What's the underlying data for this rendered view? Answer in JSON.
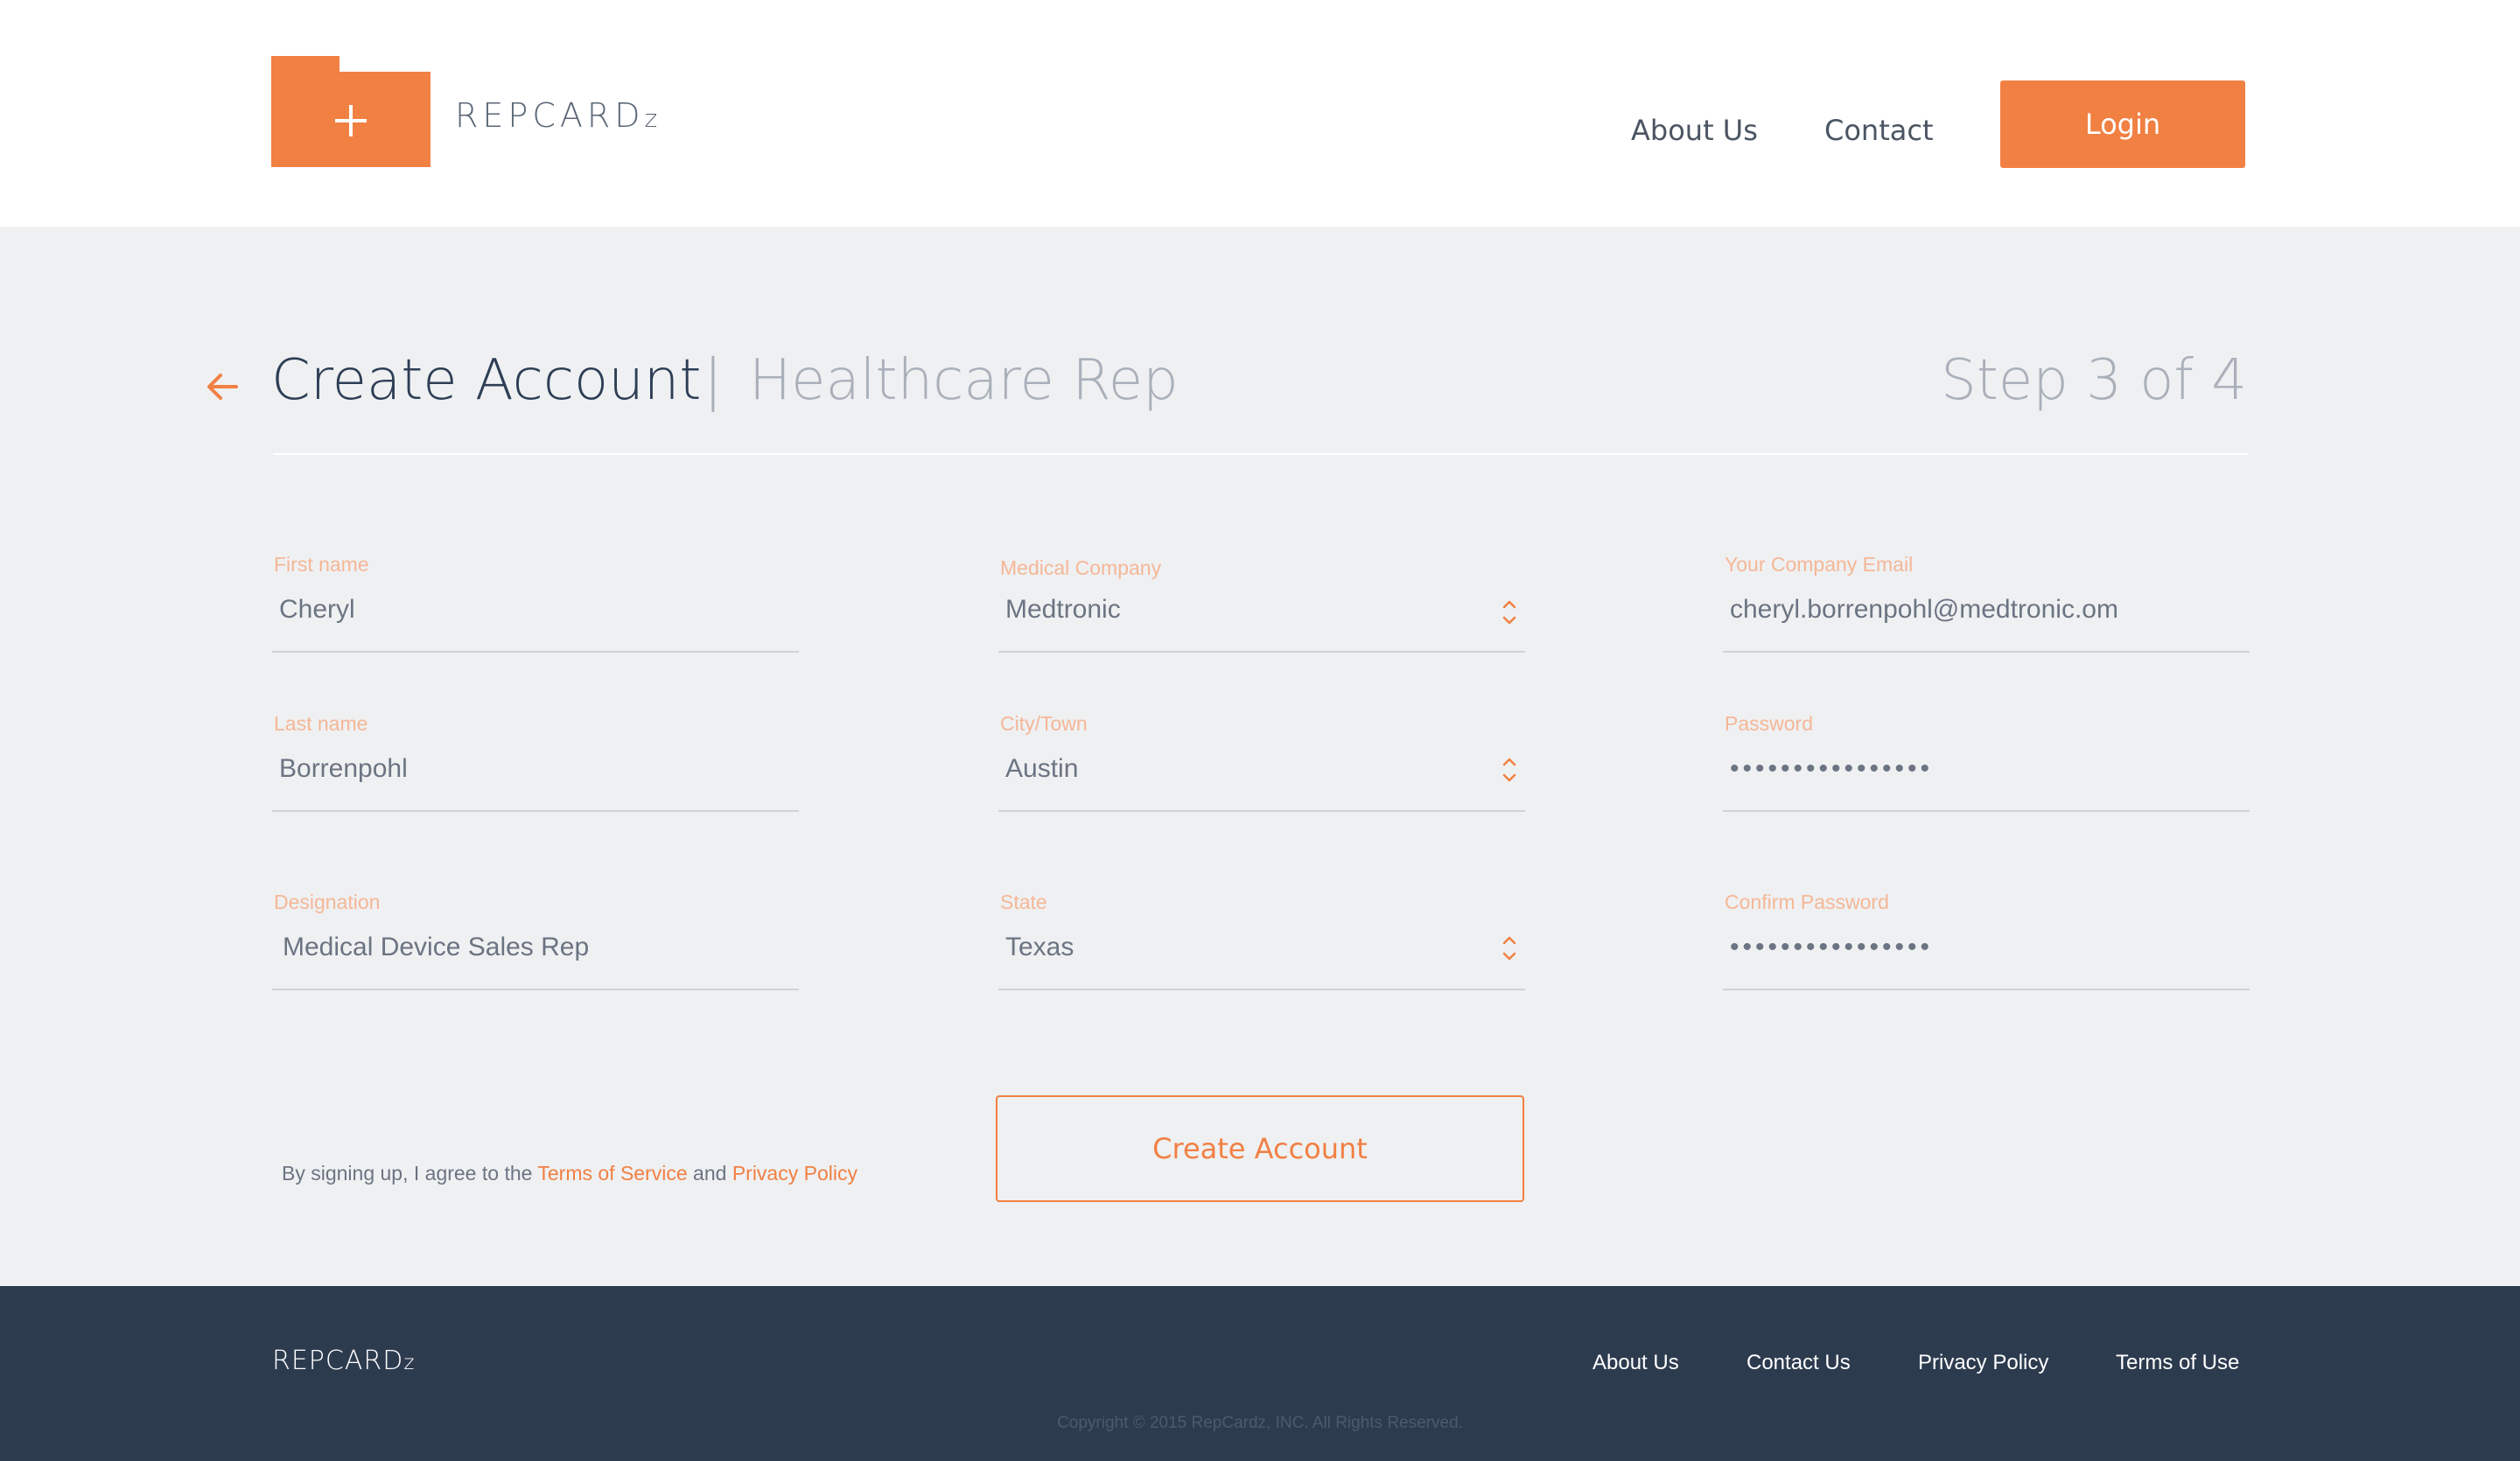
{
  "header": {
    "brand_main": "REPCARD",
    "brand_suffix": "z",
    "nav": {
      "about": "About Us",
      "contact": "Contact"
    },
    "login_label": "Login"
  },
  "page": {
    "title": "Create Account",
    "separator": "|",
    "subtitle": "Healthcare Rep",
    "step": "Step 3 of 4"
  },
  "form": {
    "first_name": {
      "label": "First name",
      "value": "Cheryl"
    },
    "last_name": {
      "label": "Last name",
      "value": "Borrenpohl"
    },
    "designation": {
      "label": "Designation",
      "value": "Medical Device Sales Rep"
    },
    "medical_company": {
      "label": "Medical Company",
      "value": "Medtronic"
    },
    "city": {
      "label": "City/Town",
      "value": "Austin"
    },
    "state": {
      "label": "State",
      "value": "Texas"
    },
    "company_email": {
      "label": "Your Company  Email",
      "value": "cheryl.borrenpohl@medtronic.om"
    },
    "password": {
      "label": "Password",
      "value": "••••••••••••••••"
    },
    "confirm_password": {
      "label": "Confirm Password",
      "value": "••••••••••••••••"
    }
  },
  "agreement": {
    "prefix": "By signing up,  I agree to the ",
    "terms_link": "Terms of Service",
    "and": " and ",
    "privacy_link": "Privacy Policy"
  },
  "create_button_label": "Create Account",
  "footer": {
    "brand_main": "REPCARD",
    "brand_suffix": "z",
    "links": {
      "about": "About Us",
      "contact": "Contact Us",
      "privacy": "Privacy Policy",
      "terms": "Terms of Use"
    },
    "copyright": "Copyright © 2015 RepCardz, INC. All Rights Reserved."
  },
  "colors": {
    "accent": "#f18043",
    "dark": "#2d3b4f",
    "background": "#eff0f2",
    "label": "#f5b797"
  },
  "icons": {
    "logo": "folder-plus-icon",
    "back": "arrow-left-icon",
    "select": "chevron-up-down-icon"
  }
}
